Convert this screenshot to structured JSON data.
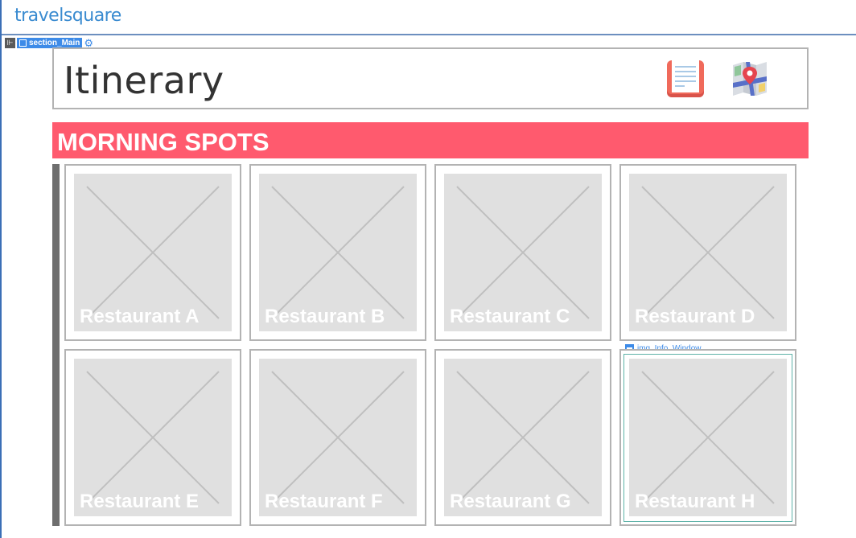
{
  "app": {
    "logo": "travelsquare"
  },
  "section_tag": {
    "label": "section_Main"
  },
  "header": {
    "title": "Itinerary"
  },
  "section": {
    "title": "MORNING SPOTS"
  },
  "info_tag": {
    "label": "img_Info_Window"
  },
  "cards": [
    {
      "name": "Restaurant A"
    },
    {
      "name": "Restaurant B"
    },
    {
      "name": "Restaurant C"
    },
    {
      "name": "Restaurant D"
    },
    {
      "name": "Restaurant E"
    },
    {
      "name": "Restaurant F"
    },
    {
      "name": "Restaurant G"
    },
    {
      "name": "Restaurant H"
    }
  ],
  "colors": {
    "accent": "#ff5a6e",
    "brand": "#3a8bd0",
    "selection": "#3d8be8"
  },
  "icons": [
    "document-icon",
    "map-icon",
    "gear-icon",
    "image-icon"
  ]
}
